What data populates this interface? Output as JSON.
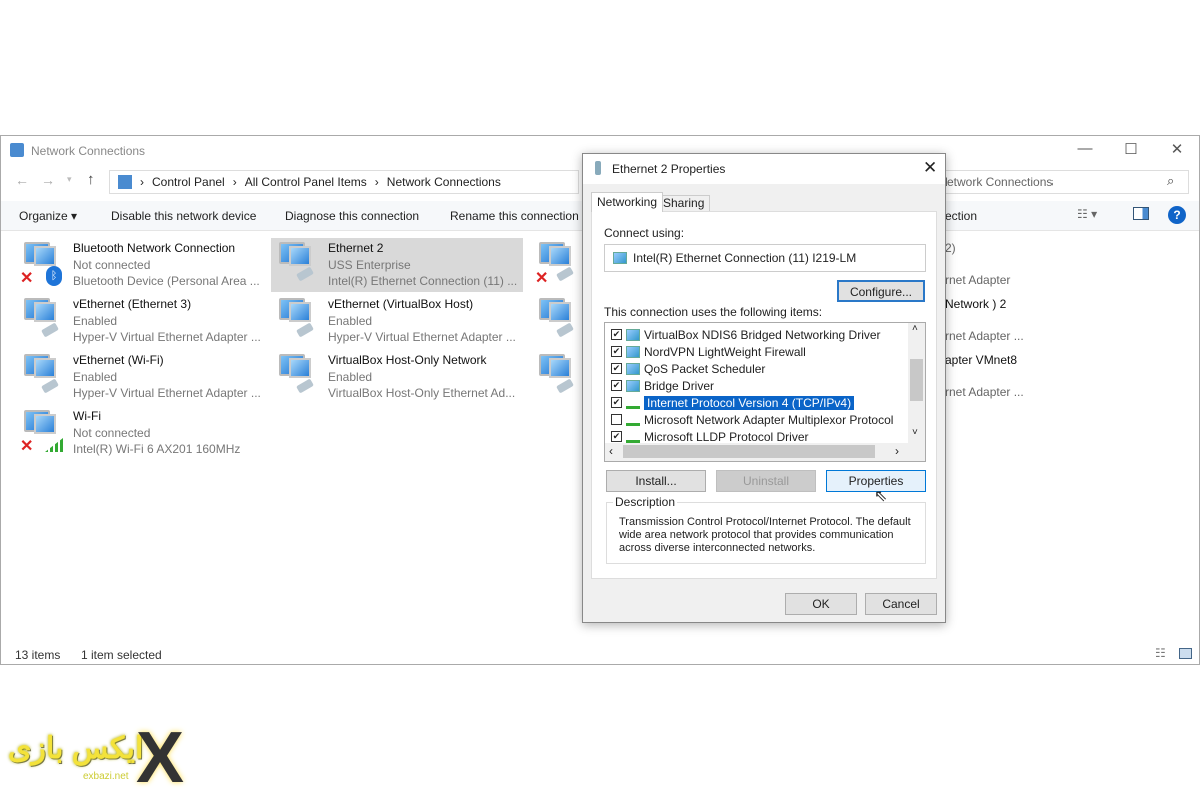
{
  "window": {
    "title": "Network Connections",
    "controls": [
      "—",
      "☐",
      "✕"
    ]
  },
  "address": {
    "parts": [
      "Control Panel",
      "All Control Panel Items",
      "Network Connections"
    ],
    "search_placeholder": "Search Network Connections",
    "search_visible": "etwork Connections"
  },
  "toolbar": {
    "organize": "Organize ▾",
    "disable": "Disable this network device",
    "diagnose": "Diagnose this connection",
    "rename": "Rename this connection",
    "rename_frag": "ection"
  },
  "items": [
    {
      "name": "Bluetooth Network Connection",
      "status": "Not connected",
      "device": "Bluetooth Device (Personal Area ...",
      "icon": "bluetooth"
    },
    {
      "name": "Ethernet 2",
      "status": "USS Enterprise",
      "device": "Intel(R) Ethernet Connection (11) ...",
      "icon": "ethernet",
      "selected": true
    },
    {
      "name": "vEthernet (Ethernet 3)",
      "status": "Enabled",
      "device": "Hyper-V Virtual Ethernet Adapter ...",
      "icon": "ethernet"
    },
    {
      "name": "vEthernet (VirtualBox Host)",
      "status": "Enabled",
      "device": "Hyper-V Virtual Ethernet Adapter ...",
      "icon": "ethernet"
    },
    {
      "name": "vEthernet (Wi-Fi)",
      "status": "Enabled",
      "device": "Hyper-V Virtual Ethernet Adapter ...",
      "icon": "ethernet"
    },
    {
      "name": "VirtualBox Host-Only Network",
      "status": "Enabled",
      "device": "VirtualBox Host-Only Ethernet Ad...",
      "icon": "ethernet"
    },
    {
      "name": "Wi-Fi",
      "status": "Not connected",
      "device": "Intel(R) Wi-Fi 6 AX201 160MHz",
      "icon": "wifi"
    }
  ],
  "hidden_column_fragments": [
    "2)",
    "rnet Adapter",
    "Network ) 2",
    "rnet Adapter ...",
    "apter VMnet8",
    "rnet Adapter ..."
  ],
  "status_bar": {
    "count": "13 items",
    "selected": "1 item selected"
  },
  "dialog": {
    "title": "Ethernet 2 Properties",
    "tabs": [
      "Networking",
      "Sharing"
    ],
    "connect_using_label": "Connect using:",
    "adapter": "Intel(R) Ethernet Connection (11) I219-LM",
    "configure": "Configure...",
    "items_label": "This connection uses the following items:",
    "components": [
      {
        "label": "VirtualBox NDIS6 Bridged Networking Driver",
        "checked": true,
        "icon": "network"
      },
      {
        "label": "NordVPN LightWeight Firewall",
        "checked": true,
        "icon": "network"
      },
      {
        "label": "QoS Packet Scheduler",
        "checked": true,
        "icon": "network"
      },
      {
        "label": "Bridge Driver",
        "checked": true,
        "icon": "network"
      },
      {
        "label": "Internet Protocol Version 4 (TCP/IPv4)",
        "checked": true,
        "icon": "protocol",
        "selected": true
      },
      {
        "label": "Microsoft Network Adapter Multiplexor Protocol",
        "checked": false,
        "icon": "protocol"
      },
      {
        "label": "Microsoft LLDP Protocol Driver",
        "checked": true,
        "icon": "protocol"
      }
    ],
    "install": "Install...",
    "uninstall": "Uninstall",
    "properties": "Properties",
    "description_label": "Description",
    "description": "Transmission Control Protocol/Internet Protocol. The default wide area network protocol that provides communication across diverse interconnected networks.",
    "ok": "OK",
    "cancel": "Cancel"
  },
  "watermark": {
    "text": "ایکس بازی",
    "domain": "exbazi.net"
  }
}
